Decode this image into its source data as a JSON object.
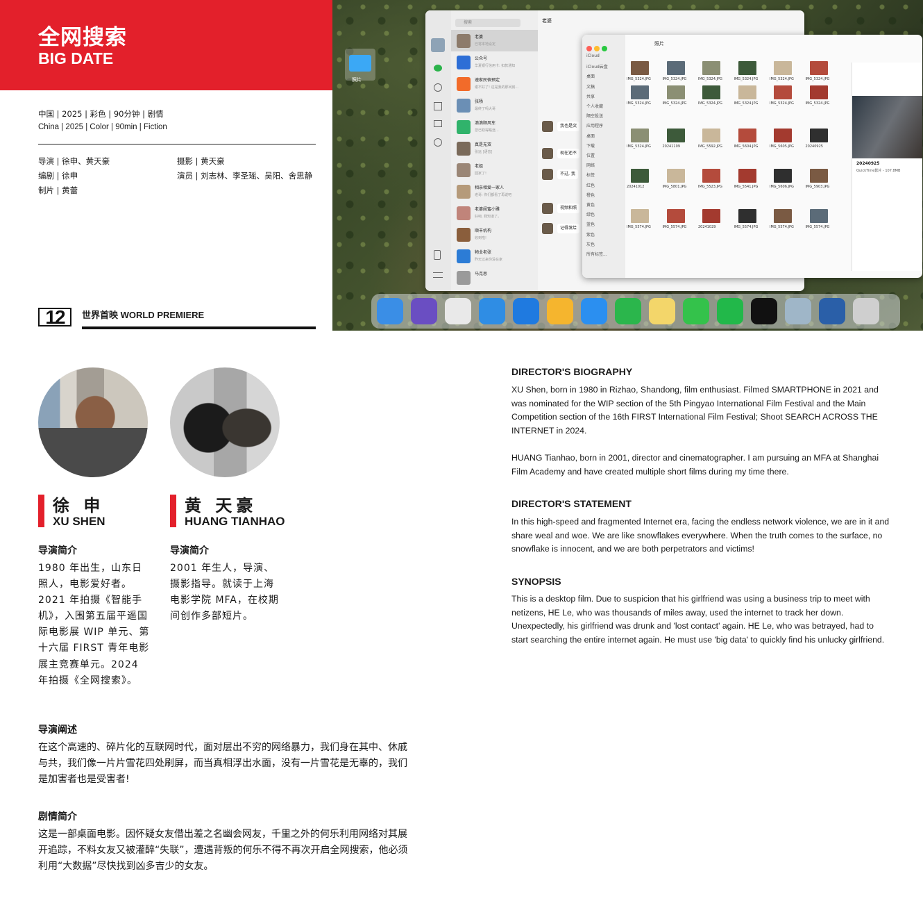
{
  "header": {
    "title_cn": "全网搜索",
    "title_en": "BIG DATE",
    "info_cn": "中国 | 2025 | 彩色 | 90分钟 | 剧情",
    "info_en": "China | 2025 | Color | 90min | Fiction"
  },
  "credits": {
    "director": "导演 | 徐申、黄天豪",
    "screenwriter": "编剧 | 徐申",
    "producer": "制片 | 黄蕾",
    "cinematographer": "摄影 | 黄天豪",
    "cast": "演员 | 刘志林、李圣瑶、吴阳、舍思静"
  },
  "premiere": {
    "number": "12",
    "label": "世界首映  WORLD PREMIERE"
  },
  "still": {
    "folder_label": "照片",
    "wechat": {
      "search_placeholder": "搜索",
      "chat_title": "老婆",
      "conversations": [
        {
          "name": "老婆",
          "message": "已将本地设定",
          "color": "#8d7b6b"
        },
        {
          "name": "公众号",
          "message": "华夏银行信用卡: 扣款通知",
          "color": "#2d6ed6"
        },
        {
          "name": "速家民宿预定",
          "message": "谢不好了! 这是我的那间房...",
          "color": "#f26b2a"
        },
        {
          "name": "张杨",
          "message": "最终了吗大哥",
          "color": "#6b8fb5"
        },
        {
          "name": "滴滴顺风车",
          "message": "您已取得路途...",
          "color": "#30b36b"
        },
        {
          "name": "真是无双",
          "message": "张远 [语音]",
          "color": "#7a6a5a"
        },
        {
          "name": "老姐",
          "message": "回家了!",
          "color": "#9a8676"
        },
        {
          "name": "相亲相爱一家人",
          "message": "老哥: 你们都看了再说吧",
          "color": "#b59a7a"
        },
        {
          "name": "老婆闺蜜小雅",
          "message": "好吧, 我知道了。",
          "color": "#c0847a"
        },
        {
          "name": "顺丰机构",
          "message": "收到啦!",
          "color": "#8a5e3c"
        },
        {
          "name": "物业老张",
          "message": "昨天过来你没在家",
          "color": "#2c7cd6"
        },
        {
          "name": "马克思",
          "message": "",
          "color": "#9a9a9a"
        }
      ],
      "bubbles": [
        "我也是突",
        "现在还不",
        "不过, 我",
        "视频和照",
        "记得发给"
      ]
    },
    "finder": {
      "title": "照片",
      "sidebar": [
        "iCloud",
        "iCloud云盘",
        "桌面",
        "文稿",
        "共享",
        "个人收藏",
        "隔空投送",
        "应用程序",
        "桌面",
        "下载",
        "位置",
        "网络",
        "标签",
        "红色",
        "橙色",
        "黄色",
        "绿色",
        "蓝色",
        "紫色",
        "灰色",
        "所有标签..."
      ],
      "files": [
        "IMG_5324.JPG",
        "IMG_5324.JPG",
        "IMG_5324.JPG",
        "IMG_5324.JPG",
        "IMG_5324.JPG",
        "IMG_5324.JPG",
        "IMG_5324.JPG",
        "IMG_5324.JPG",
        "IMG_5324.JPG",
        "IMG_5324.JPG",
        "IMG_5324.JPG",
        "IMG_5324.JPG",
        "IMG_5324.JPG",
        "20241109",
        "IMG_5592.JPG",
        "IMG_5604.JPG",
        "IMG_5605.JPG",
        "20240925",
        "20241012",
        "IMG_5801.JPG",
        "IMG_5523.JPG",
        "IMG_5541.JPG",
        "IMG_5606.JPG",
        "IMG_5903.JPG",
        "IMG_5574.JPG",
        "IMG_5574.JPG",
        "20241029",
        "IMG_5574.JPG",
        "IMG_5574.JPG",
        "IMG_5574.JPG"
      ],
      "preview_name": "20240925",
      "preview_meta": "QuickTime影片 - 107.8MB"
    },
    "dock": [
      "finder-icon",
      "siri-icon",
      "launchpad-icon",
      "mail-icon",
      "app-store-icon",
      "pages-icon",
      "safari-icon",
      "facetime-icon",
      "notes-icon",
      "messages-icon",
      "wechat-icon",
      "tiktok-icon",
      "preview-icon",
      "quicktime-icon",
      "trash-icon"
    ]
  },
  "directors": [
    {
      "name_cn": "徐 申",
      "name_en": "XU SHEN",
      "bio_heading": "导演简介",
      "bio": "1980 年出生，山东日照人，电影爱好者。2021 年拍摄《智能手机》，入围第五届平遥国际电影展 WIP 单元、第十六届 FIRST 青年电影展主竞赛单元。2024 年拍摄《全网搜索》。"
    },
    {
      "name_cn": "黄 天豪",
      "name_en": "HUANG TIANHAO",
      "bio_heading": "导演简介",
      "bio": "2001 年生人，导演、摄影指导。就读于上海电影学院 MFA，在校期间创作多部短片。"
    }
  ],
  "statement_cn": {
    "heading": "导演阐述",
    "text": "在这个高速的、碎片化的互联网时代，面对层出不穷的网络暴力，我们身在其中、休戚与共，我们像一片片雪花四处刷屏，而当真相浮出水面，没有一片雪花是无辜的，我们是加害者也是受害者!"
  },
  "synopsis_cn": {
    "heading": "剧情简介",
    "text": "这是一部桌面电影。因怀疑女友借出差之名幽会网友，千里之外的何乐利用网络对其展开追踪，不料女友又被灌醉“失联”，遭遇背叛的何乐不得不再次开启全网搜索，他必须利用“大数据”尽快找到凶多吉少的女友。"
  },
  "english": {
    "bio_heading": "DIRECTOR'S BIOGRAPHY",
    "bio_1": "XU Shen, born in 1980 in Rizhao, Shandong, film enthusiast. Filmed SMARTPHONE in 2021 and was nominated for the WIP section of the 5th Pingyao International Film Festival and the Main Competition section of the 16th FIRST International Film Festival; Shoot SEARCH ACROSS THE INTERNET in 2024.",
    "bio_2": "HUANG Tianhao, born in 2001, director and cinematographer. I am pursuing an MFA at Shanghai Film Academy and have created multiple short films during my time there.",
    "statement_heading": "DIRECTOR'S STATEMENT",
    "statement": "In this high-speed and fragmented Internet era, facing the endless network violence, we are in it and share weal and woe. We are like snowflakes everywhere. When the truth comes to the surface, no snowflake is innocent, and we are both perpetrators and victims!",
    "synopsis_heading": "SYNOPSIS",
    "synopsis": "This is a desktop film. Due to suspicion that his girlfriend was using a business trip to meet with netizens, HE Le, who was thousands of miles away, used the internet to track her down. Unexpectedly, his girlfriend was drunk and 'lost contact' again. HE Le, who was betrayed, had to start searching the entire internet again. He must use 'big data' to quickly find his unlucky girlfriend."
  },
  "colors": {
    "accent_red": "#e3202b",
    "text": "#1a1a1a"
  }
}
